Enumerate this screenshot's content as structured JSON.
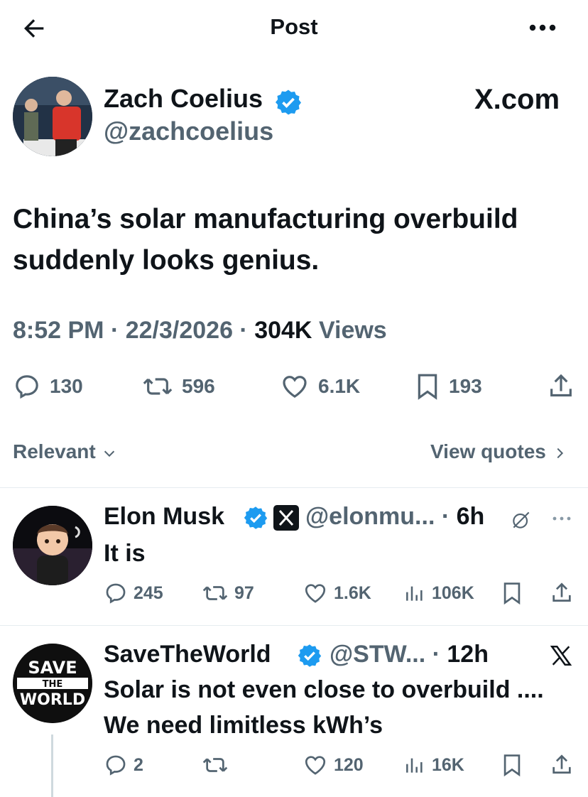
{
  "header": {
    "title": "Post"
  },
  "main_post": {
    "name": "Zach Coelius",
    "handle": "@zachcoelius",
    "watermark": "X.com",
    "text": "China’s solar manufacturing overbuild suddenly looks genius.",
    "time": "8:52 PM",
    "date": "22/3/2026",
    "views_count": "304K",
    "views_label": "Views",
    "stats": {
      "replies": "130",
      "reposts": "596",
      "likes": "6.1K",
      "bookmarks": "193"
    }
  },
  "filters": {
    "relevant": "Relevant",
    "view_quotes": "View quotes"
  },
  "replies": [
    {
      "name": "Elon Musk",
      "handle": "@elonmu...",
      "time": "6h",
      "text": "It is",
      "stats": {
        "replies": "245",
        "reposts": "97",
        "likes": "1.6K",
        "views": "106K"
      }
    },
    {
      "name": "SaveTheWorld",
      "handle": "@STW...",
      "time": "12h",
      "text": "Solar is not even close to overbuild .... We need limitless kWh’s",
      "avatar_text": {
        "top": "SAVE",
        "middle": "THE",
        "bottom": "WORLD"
      },
      "stats": {
        "replies": "2",
        "likes": "120",
        "views": "16K"
      }
    }
  ],
  "colors": {
    "verified": "#1d9bf0",
    "secondary_text": "#536471",
    "divider": "#e6ecf0"
  }
}
